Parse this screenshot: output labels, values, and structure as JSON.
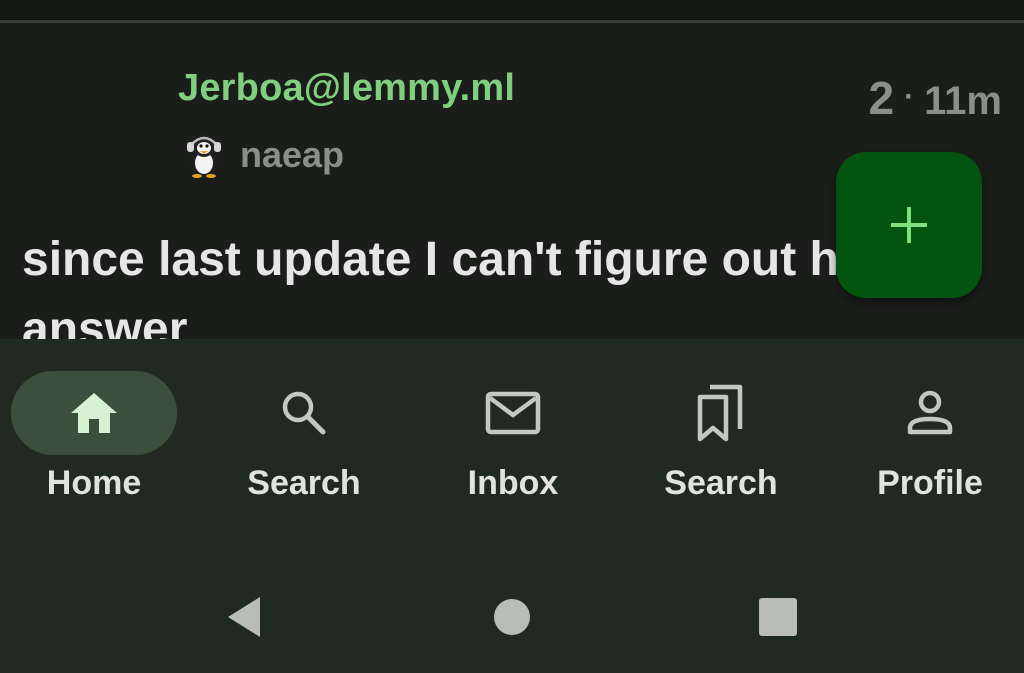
{
  "post": {
    "community": "Jerboa@lemmy.ml",
    "author": "naeap",
    "score": "2",
    "separator": "·",
    "time": "11m",
    "title": "since last update I can't figure out how to answer"
  },
  "fab": {
    "icon": "plus-icon"
  },
  "nav": {
    "items": [
      {
        "label": "Home",
        "icon": "home-icon",
        "active": true
      },
      {
        "label": "Search",
        "icon": "search-icon",
        "active": false
      },
      {
        "label": "Inbox",
        "icon": "mail-icon",
        "active": false
      },
      {
        "label": "Search",
        "icon": "bookmarks-icon",
        "active": false
      },
      {
        "label": "Profile",
        "icon": "person-icon",
        "active": false
      }
    ]
  },
  "system_nav": [
    "back-icon",
    "home-circle-icon",
    "recents-icon"
  ],
  "colors": {
    "background": "#1b1d1b",
    "community": "#7fcf7f",
    "muted": "#8c8e8c",
    "title": "#e6e6e6",
    "fab": "#03540f",
    "fab_icon": "#7fe07f",
    "navbar": "#212a22",
    "nav_active": "#3c4f3c",
    "nav_active_icon": "#d7f2d2",
    "nav_icon": "#c4c8c3"
  }
}
